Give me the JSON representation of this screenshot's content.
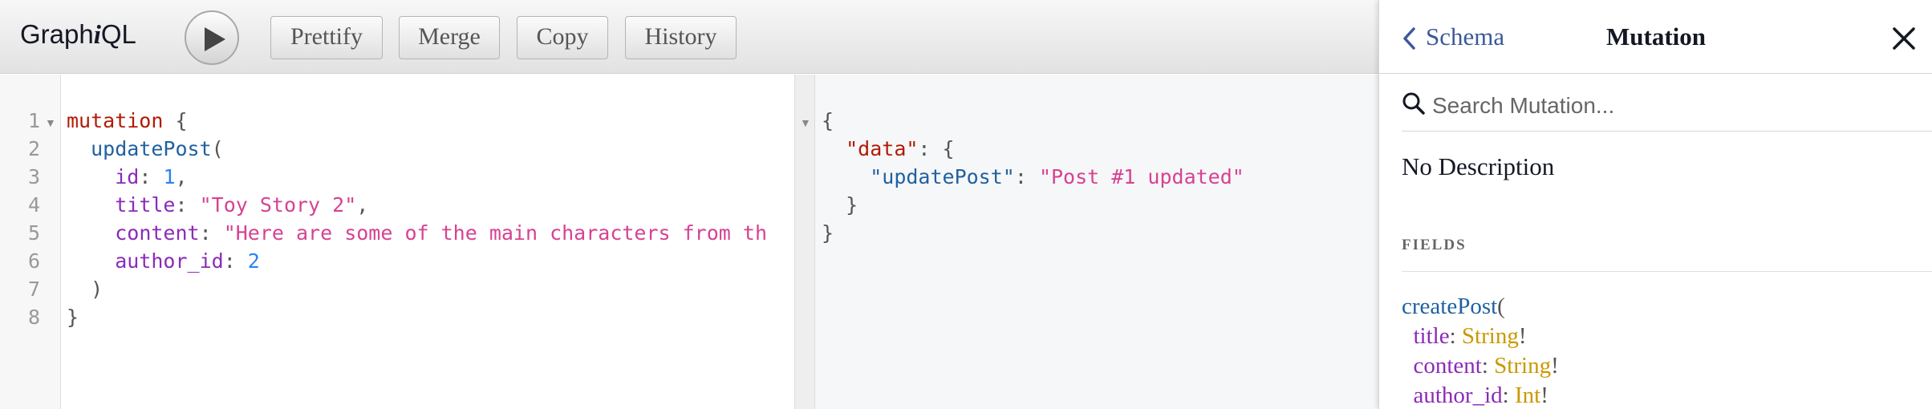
{
  "app": {
    "title_prefix": "Graph",
    "title_italic": "i",
    "title_suffix": "QL"
  },
  "toolbar": {
    "run_icon": "play-icon",
    "buttons": [
      "Prettify",
      "Merge",
      "Copy",
      "History"
    ]
  },
  "query_editor": {
    "line_numbers": [
      "1",
      "2",
      "3",
      "4",
      "5",
      "6",
      "7",
      "8"
    ],
    "lines": {
      "l1_keyword": "mutation",
      "l1_brace": " {",
      "l2_field": "updatePost",
      "l2_paren": "(",
      "l3_arg": "id",
      "l3_colon": ": ",
      "l3_value": "1",
      "l3_comma": ",",
      "l4_arg": "title",
      "l4_colon": ": ",
      "l4_value": "\"Toy Story 2\"",
      "l4_comma": ",",
      "l5_arg": "content",
      "l5_colon": ": ",
      "l5_value": "\"Here are some of the main characters from th",
      "l6_arg": "author_id",
      "l6_colon": ": ",
      "l6_value": "2",
      "l7_paren": ")",
      "l8_brace": "}"
    }
  },
  "result_viewer": {
    "l1": "{",
    "l2_key": "\"data\"",
    "l2_rest": ": {",
    "l3_key": "\"updatePost\"",
    "l3_colon": ": ",
    "l3_value": "\"Post #1 updated\"",
    "l4": "}",
    "l5": "}"
  },
  "docs": {
    "back_label": "Schema",
    "title": "Mutation",
    "search_placeholder": "Search Mutation...",
    "description": "No Description",
    "fields_heading": "FIELDS",
    "field": {
      "name": "createPost",
      "open_paren": "(",
      "args": [
        {
          "name": "title",
          "type": "String",
          "bang": "!"
        },
        {
          "name": "content",
          "type": "String",
          "bang": "!"
        },
        {
          "name": "author_id",
          "type": "Int",
          "bang": "!"
        }
      ]
    }
  }
}
